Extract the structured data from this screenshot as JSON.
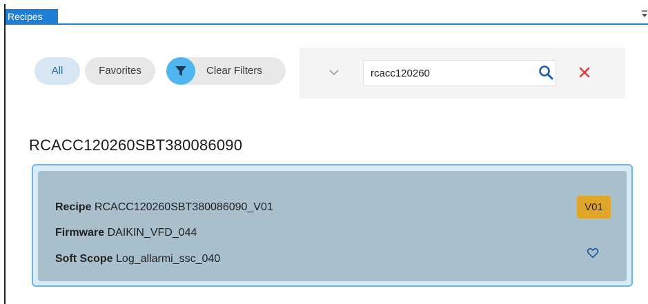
{
  "window": {
    "tab_title": "Recipes",
    "pin_icon": "pin-icon"
  },
  "filters": {
    "all_label": "All",
    "favorites_label": "Favorites",
    "clear_filters_label": "Clear Filters",
    "funnel_icon": "filter-icon",
    "accent_color": "#4fb6f2"
  },
  "search": {
    "value": "rcacc120260",
    "dropdown_icon": "chevron-down-icon",
    "search_icon": "search-icon",
    "clear_icon": "close-icon",
    "clear_color": "#e0413a",
    "search_color": "#1f5fa8"
  },
  "group": {
    "title": "RCACC120260SBT380086090"
  },
  "recipe_card": {
    "recipe_label": "Recipe",
    "recipe_value": "RCACC120260SBT380086090_V01",
    "firmware_label": "Firmware",
    "firmware_value": "DAIKIN_VFD_044",
    "softscope_label": "Soft Scope",
    "softscope_value": "Log_allarmi_ssc_040",
    "version_badge": "V01",
    "badge_color": "#e0a62a",
    "favorite_icon": "heart-icon"
  }
}
